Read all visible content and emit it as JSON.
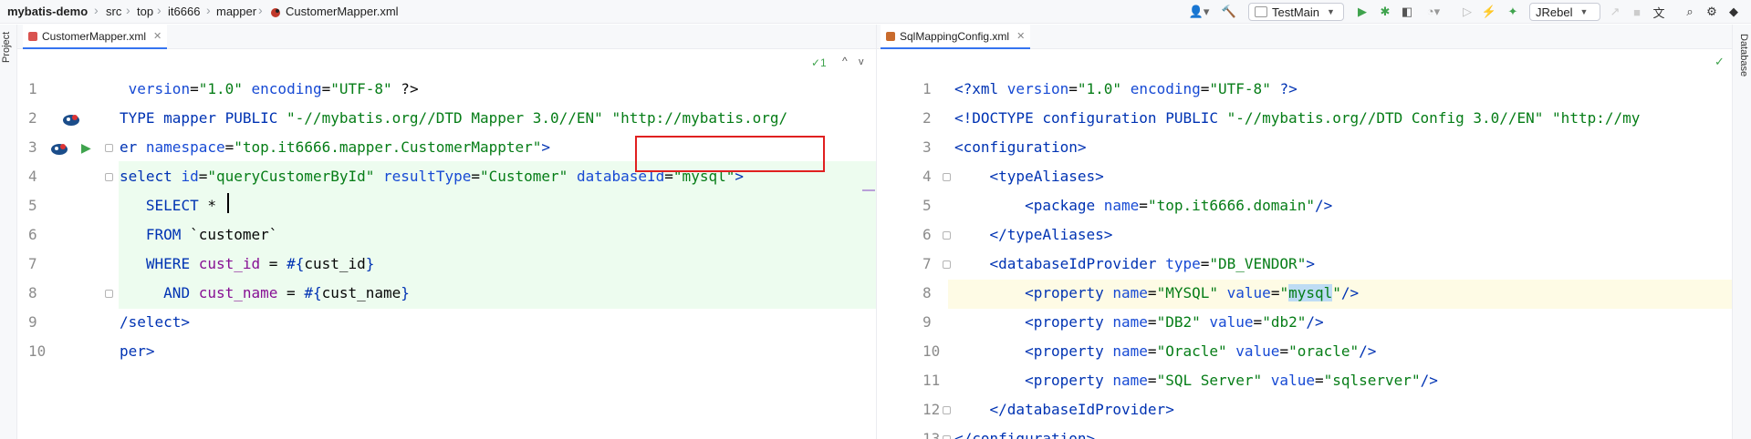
{
  "breadcrumb": {
    "project": "mybatis-demo",
    "items": [
      "src",
      "top",
      "it6666",
      "mapper"
    ],
    "file": "CustomerMapper.xml"
  },
  "toolbar": {
    "run_config": "TestMain",
    "jrebel": "JRebel"
  },
  "side": {
    "project_label": "Project",
    "database_label": "Database"
  },
  "left": {
    "tab": "CustomerMapper.xml",
    "inspection": "✓1",
    "line_numbers": [
      "1",
      "2",
      "3",
      "4",
      "5",
      "6",
      "7",
      "8",
      "9",
      "10"
    ],
    "lines": [
      [
        {
          "c": "p",
          "t": " "
        },
        {
          "c": "a",
          "t": "version"
        },
        {
          "c": "p",
          "t": "="
        },
        {
          "c": "s",
          "t": "\"1.0\""
        },
        {
          "c": "p",
          "t": " "
        },
        {
          "c": "a",
          "t": "encoding"
        },
        {
          "c": "p",
          "t": "="
        },
        {
          "c": "s",
          "t": "\"UTF-8\""
        },
        {
          "c": "p",
          "t": " ?>"
        }
      ],
      [
        {
          "c": "t",
          "t": "TYPE mapper PUBLIC "
        },
        {
          "c": "s",
          "t": "\"-//mybatis.org//DTD Mapper 3.0//EN\""
        },
        {
          "c": "p",
          "t": " "
        },
        {
          "c": "s",
          "t": "\"http://mybatis.org/"
        }
      ],
      [
        {
          "c": "t",
          "t": "er "
        },
        {
          "c": "a",
          "t": "namespace"
        },
        {
          "c": "p",
          "t": "="
        },
        {
          "c": "s",
          "t": "\"top.it6666.mapper.CustomerMappter\""
        },
        {
          "c": "t",
          "t": ">"
        }
      ],
      [
        {
          "c": "t",
          "t": "select "
        },
        {
          "c": "a",
          "t": "id"
        },
        {
          "c": "p",
          "t": "="
        },
        {
          "c": "s",
          "t": "\"queryCustomerById\""
        },
        {
          "c": "p",
          "t": " "
        },
        {
          "c": "a",
          "t": "resultType"
        },
        {
          "c": "p",
          "t": "="
        },
        {
          "c": "s",
          "t": "\"Customer\""
        },
        {
          "c": "p",
          "t": " "
        },
        {
          "c": "a",
          "t": "databaseId"
        },
        {
          "c": "p",
          "t": "="
        },
        {
          "c": "s",
          "t": "\"mysql\""
        },
        {
          "c": "t",
          "t": ">"
        }
      ],
      [
        {
          "c": "p",
          "t": "   "
        },
        {
          "c": "k",
          "t": "SELECT"
        },
        {
          "c": "p",
          "t": " *"
        }
      ],
      [
        {
          "c": "p",
          "t": "   "
        },
        {
          "c": "k",
          "t": "FROM"
        },
        {
          "c": "p",
          "t": " `customer`"
        }
      ],
      [
        {
          "c": "p",
          "t": "   "
        },
        {
          "c": "k",
          "t": "WHERE"
        },
        {
          "c": "p",
          "t": " "
        },
        {
          "c": "v",
          "t": "cust_id"
        },
        {
          "c": "p",
          "t": " = "
        },
        {
          "c": "k",
          "t": "#{"
        },
        {
          "c": "p",
          "t": "cust_id"
        },
        {
          "c": "k",
          "t": "}"
        }
      ],
      [
        {
          "c": "p",
          "t": "     "
        },
        {
          "c": "k",
          "t": "AND"
        },
        {
          "c": "p",
          "t": " "
        },
        {
          "c": "v",
          "t": "cust_name"
        },
        {
          "c": "p",
          "t": " = "
        },
        {
          "c": "k",
          "t": "#{"
        },
        {
          "c": "p",
          "t": "cust_name"
        },
        {
          "c": "k",
          "t": "}"
        }
      ],
      [
        {
          "c": "t",
          "t": "/select>"
        }
      ],
      [
        {
          "c": "t",
          "t": "per>"
        }
      ]
    ]
  },
  "right": {
    "tab": "SqlMappingConfig.xml",
    "line_numbers": [
      "1",
      "2",
      "3",
      "4",
      "5",
      "6",
      "7",
      "8",
      "9",
      "10",
      "11",
      "12",
      "13"
    ],
    "lines": [
      [
        {
          "c": "t",
          "t": "<?xml "
        },
        {
          "c": "a",
          "t": "version"
        },
        {
          "c": "p",
          "t": "="
        },
        {
          "c": "s",
          "t": "\"1.0\""
        },
        {
          "c": "p",
          "t": " "
        },
        {
          "c": "a",
          "t": "encoding"
        },
        {
          "c": "p",
          "t": "="
        },
        {
          "c": "s",
          "t": "\"UTF-8\""
        },
        {
          "c": "t",
          "t": " ?>"
        }
      ],
      [
        {
          "c": "t",
          "t": "<!DOCTYPE configuration PUBLIC "
        },
        {
          "c": "s",
          "t": "\"-//mybatis.org//DTD Config 3.0//EN\""
        },
        {
          "c": "p",
          "t": " "
        },
        {
          "c": "s",
          "t": "\"http://my"
        }
      ],
      [
        {
          "c": "t",
          "t": "<configuration>"
        }
      ],
      [
        {
          "c": "p",
          "t": "    "
        },
        {
          "c": "t",
          "t": "<typeAliases>"
        }
      ],
      [
        {
          "c": "p",
          "t": "        "
        },
        {
          "c": "t",
          "t": "<package "
        },
        {
          "c": "a",
          "t": "name"
        },
        {
          "c": "p",
          "t": "="
        },
        {
          "c": "s",
          "t": "\"top.it6666.domain\""
        },
        {
          "c": "t",
          "t": "/>"
        }
      ],
      [
        {
          "c": "p",
          "t": "    "
        },
        {
          "c": "t",
          "t": "</typeAliases>"
        }
      ],
      [
        {
          "c": "p",
          "t": "    "
        },
        {
          "c": "t",
          "t": "<databaseIdProvider "
        },
        {
          "c": "a",
          "t": "type"
        },
        {
          "c": "p",
          "t": "="
        },
        {
          "c": "s",
          "t": "\"DB_VENDOR\""
        },
        {
          "c": "t",
          "t": ">"
        }
      ],
      [
        {
          "c": "p",
          "t": "        "
        },
        {
          "c": "t",
          "t": "<property "
        },
        {
          "c": "a",
          "t": "name"
        },
        {
          "c": "p",
          "t": "="
        },
        {
          "c": "s",
          "t": "\"MYSQL\""
        },
        {
          "c": "p",
          "t": " "
        },
        {
          "c": "a",
          "t": "value"
        },
        {
          "c": "p",
          "t": "="
        },
        {
          "c": "s",
          "t": "\""
        },
        {
          "c": "s sel",
          "t": "mysql"
        },
        {
          "c": "s",
          "t": "\""
        },
        {
          "c": "t",
          "t": "/>"
        }
      ],
      [
        {
          "c": "p",
          "t": "        "
        },
        {
          "c": "t",
          "t": "<property "
        },
        {
          "c": "a",
          "t": "name"
        },
        {
          "c": "p",
          "t": "="
        },
        {
          "c": "s",
          "t": "\"DB2\""
        },
        {
          "c": "p",
          "t": " "
        },
        {
          "c": "a",
          "t": "value"
        },
        {
          "c": "p",
          "t": "="
        },
        {
          "c": "s",
          "t": "\"db2\""
        },
        {
          "c": "t",
          "t": "/>"
        }
      ],
      [
        {
          "c": "p",
          "t": "        "
        },
        {
          "c": "t",
          "t": "<property "
        },
        {
          "c": "a",
          "t": "name"
        },
        {
          "c": "p",
          "t": "="
        },
        {
          "c": "s",
          "t": "\"Oracle\""
        },
        {
          "c": "p",
          "t": " "
        },
        {
          "c": "a",
          "t": "value"
        },
        {
          "c": "p",
          "t": "="
        },
        {
          "c": "s",
          "t": "\"oracle\""
        },
        {
          "c": "t",
          "t": "/>"
        }
      ],
      [
        {
          "c": "p",
          "t": "        "
        },
        {
          "c": "t",
          "t": "<property "
        },
        {
          "c": "a",
          "t": "name"
        },
        {
          "c": "p",
          "t": "="
        },
        {
          "c": "s",
          "t": "\"SQL Server\""
        },
        {
          "c": "p",
          "t": " "
        },
        {
          "c": "a",
          "t": "value"
        },
        {
          "c": "p",
          "t": "="
        },
        {
          "c": "s",
          "t": "\"sqlserver\""
        },
        {
          "c": "t",
          "t": "/>"
        }
      ],
      [
        {
          "c": "p",
          "t": "    "
        },
        {
          "c": "t",
          "t": "</databaseIdProvider>"
        }
      ],
      [
        {
          "c": "t",
          "t": "</configuration>"
        }
      ]
    ]
  }
}
